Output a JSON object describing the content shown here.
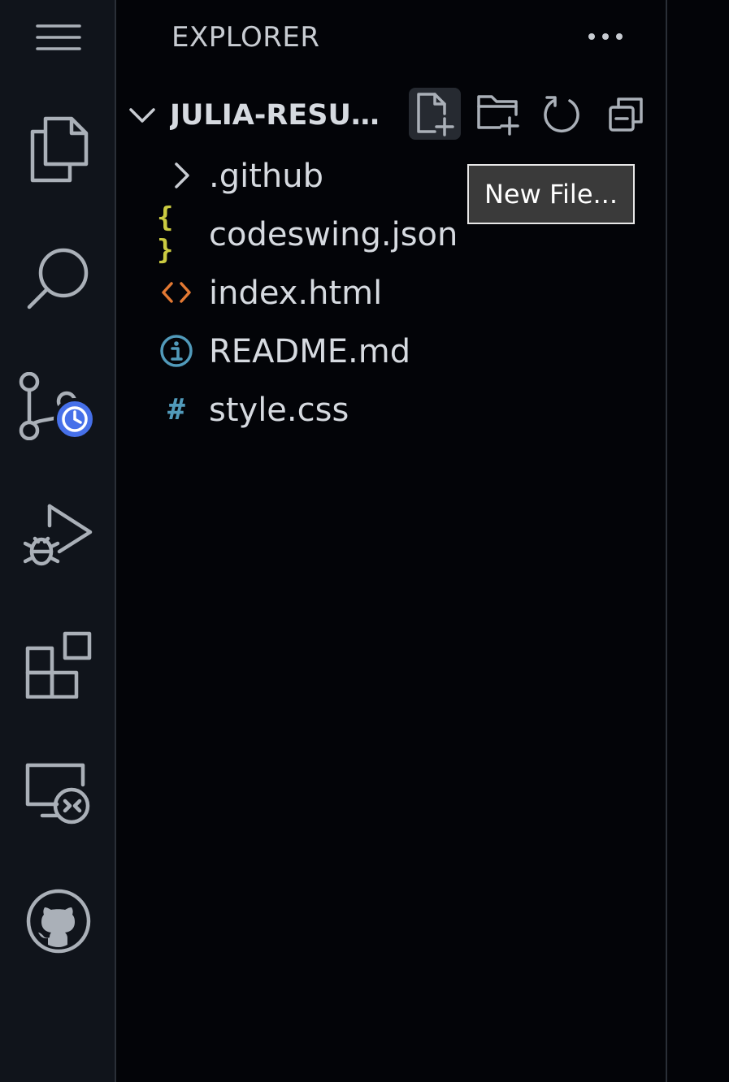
{
  "activity_bar": {
    "items": [
      {
        "name": "menu",
        "icon": "hamburger-menu-icon"
      },
      {
        "name": "explorer",
        "icon": "files-icon"
      },
      {
        "name": "search",
        "icon": "search-icon"
      },
      {
        "name": "source-control",
        "icon": "source-control-icon",
        "badge_icon": "clock-icon"
      },
      {
        "name": "run-debug",
        "icon": "run-debug-icon"
      },
      {
        "name": "extensions",
        "icon": "extensions-icon"
      },
      {
        "name": "remote-explorer",
        "icon": "remote-explorer-icon"
      },
      {
        "name": "github",
        "icon": "github-icon"
      }
    ],
    "badge_color": "#4670e9"
  },
  "sidebar": {
    "title": "EXPLORER",
    "more_label": "•••",
    "folder": {
      "name": "JULIA-RESUME...",
      "expanded": true
    },
    "tree": [
      {
        "label": ".github",
        "type": "folder",
        "icon": "chevron-right-icon",
        "icon_color": "#c8ccd2"
      },
      {
        "label": "codeswing.json",
        "type": "file",
        "icon": "json-braces-icon",
        "icon_glyph": "{ }",
        "icon_color": "#cbcb41"
      },
      {
        "label": "index.html",
        "type": "file",
        "icon": "html-brackets-icon",
        "icon_glyph": "<>",
        "icon_color": "#e37933"
      },
      {
        "label": "README.md",
        "type": "file",
        "icon": "info-icon",
        "icon_glyph": "i",
        "icon_color": "#519aba"
      },
      {
        "label": "style.css",
        "type": "file",
        "icon": "hash-icon",
        "icon_glyph": "#",
        "icon_color": "#519aba"
      }
    ]
  },
  "tooltip": {
    "text": "New File..."
  }
}
